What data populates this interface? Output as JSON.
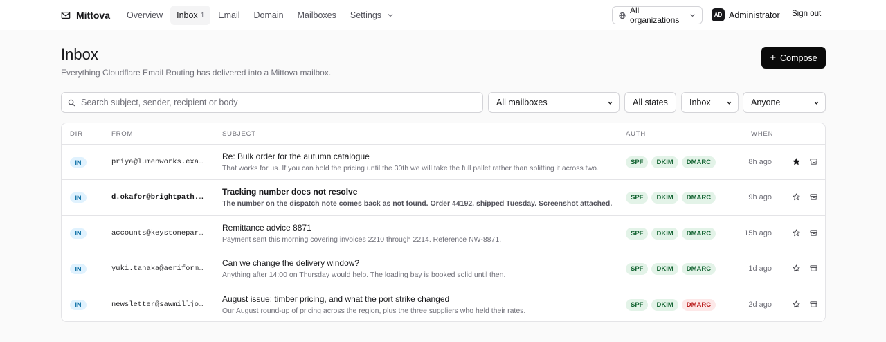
{
  "app": {
    "name": "Mittova",
    "logo_icon": "mail-icon"
  },
  "nav": {
    "items": [
      {
        "label": "Overview"
      },
      {
        "label": "Inbox",
        "count": "1",
        "active": true
      },
      {
        "label": "Email"
      },
      {
        "label": "Domain"
      },
      {
        "label": "Mailboxes"
      },
      {
        "label": "Settings",
        "has_dropdown": true
      }
    ]
  },
  "org_select": {
    "value": "All organizations",
    "icon": "globe-icon"
  },
  "user": {
    "initials": "AD",
    "name": "Administrator"
  },
  "sign_out": "Sign out",
  "page": {
    "title": "Inbox",
    "subtitle": "Everything Cloudflare Email Routing has delivered into a Mittova mailbox.",
    "compose_label": "Compose"
  },
  "filters": {
    "search_placeholder": "Search subject, sender, recipient or body",
    "mailbox": "All mailboxes",
    "states": "All states",
    "folder": "Inbox",
    "assignee": "Anyone"
  },
  "table": {
    "columns": {
      "dir": "DIR",
      "from": "FROM",
      "subject": "SUBJECT",
      "auth": "AUTH",
      "when": "WHEN"
    },
    "rows": [
      {
        "dir": "IN",
        "from": "priya@lumenworks.example",
        "subject": "Re: Bulk order for the autumn catalogue",
        "preview": "That works for us. If you can hold the pricing until the 30th we will take the full pallet rather than splitting it across two.",
        "auth": [
          "SPF",
          "DKIM",
          "DMARC"
        ],
        "dmarc_fail": false,
        "when": "8h ago",
        "starred": true,
        "unread": false
      },
      {
        "dir": "IN",
        "from": "d.okafor@brightpath.example",
        "subject": "Tracking number does not resolve",
        "preview": "The number on the dispatch note comes back as not found. Order 44192, shipped Tuesday. Screenshot attached.",
        "auth": [
          "SPF",
          "DKIM",
          "DMARC"
        ],
        "dmarc_fail": false,
        "when": "9h ago",
        "starred": false,
        "unread": true
      },
      {
        "dir": "IN",
        "from": "accounts@keystonepartners.example",
        "subject": "Remittance advice 8871",
        "preview": "Payment sent this morning covering invoices 2210 through 2214. Reference NW-8871.",
        "auth": [
          "SPF",
          "DKIM",
          "DMARC"
        ],
        "dmarc_fail": false,
        "when": "15h ago",
        "starred": false,
        "unread": false
      },
      {
        "dir": "IN",
        "from": "yuki.tanaka@aeriform.example",
        "subject": "Can we change the delivery window?",
        "preview": "Anything after 14:00 on Thursday would help. The loading bay is booked solid until then.",
        "auth": [
          "SPF",
          "DKIM",
          "DMARC"
        ],
        "dmarc_fail": false,
        "when": "1d ago",
        "starred": false,
        "unread": false
      },
      {
        "dir": "IN",
        "from": "newsletter@sawmilljournal.example",
        "subject": "August issue: timber pricing, and what the port strike changed",
        "preview": "Our August round-up of pricing across the region, plus the three suppliers who held their rates.",
        "auth": [
          "SPF",
          "DKIM",
          "DMARC"
        ],
        "dmarc_fail": true,
        "when": "2d ago",
        "starred": false,
        "unread": false
      }
    ]
  }
}
